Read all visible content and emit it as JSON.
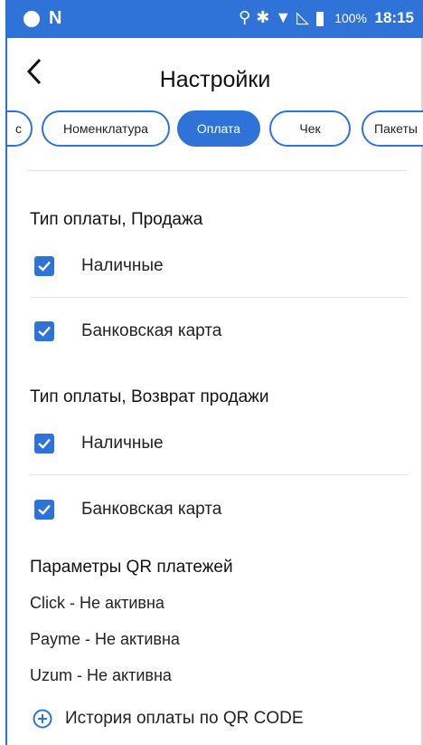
{
  "status_bar": {
    "battery_percent": "100%",
    "time": "18:15",
    "carrier_letter": "N",
    "icons": [
      "location-icon",
      "bluetooth-icon",
      "wifi-icon",
      "no-signal-icon",
      "battery-icon"
    ]
  },
  "appbar": {
    "title": "Настройки"
  },
  "tabs": [
    {
      "label": "с",
      "active": false
    },
    {
      "label": "Номенклатура",
      "active": false
    },
    {
      "label": "Оплата",
      "active": true
    },
    {
      "label": "Чек",
      "active": false
    },
    {
      "label": "Пакеты",
      "active": false
    }
  ],
  "sale": {
    "title": "Тип оплаты, Продажа",
    "options": [
      {
        "label": "Наличные",
        "checked": true
      },
      {
        "label": "Банковская карта",
        "checked": true
      }
    ]
  },
  "refund": {
    "title": "Тип оплаты, Возврат продажи",
    "options": [
      {
        "label": "Наличные",
        "checked": true
      },
      {
        "label": "Банковская карта",
        "checked": true
      }
    ]
  },
  "qr": {
    "title": "Параметры QR платежей",
    "items": [
      "Click - Не активна",
      "Payme - Не активна",
      "Uzum - Не активна"
    ],
    "history_link": "История оплаты по QR CODE"
  },
  "colors": {
    "accent": "#2f73d8",
    "divider": "#e3e3e3"
  }
}
